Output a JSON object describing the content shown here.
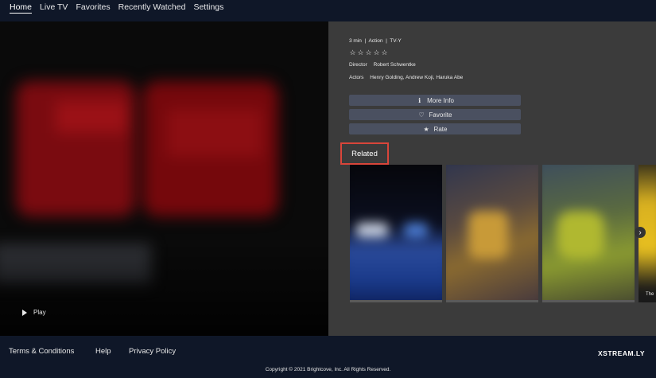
{
  "nav": {
    "items": [
      {
        "label": "Home"
      },
      {
        "label": "Live TV"
      },
      {
        "label": "Favorites"
      },
      {
        "label": "Recently Watched"
      },
      {
        "label": "Settings"
      }
    ]
  },
  "hero": {
    "play_label": "Play"
  },
  "details": {
    "meta": "3 min  |  Action  |  TV-Y",
    "stars": [
      "☆",
      "☆",
      "☆",
      "☆",
      "☆"
    ],
    "director_label": "Director",
    "director": "Robert Schwentke",
    "actors_label": "Actors",
    "actors": "Henry Golding, Andrew Koji, Haruka Abe",
    "buttons": {
      "more_info": "More Info",
      "favorite": "Favorite",
      "rate": "Rate"
    },
    "icons": {
      "more_info": "ℹ",
      "favorite": "♡",
      "rate": "★"
    }
  },
  "related": {
    "title": "Related",
    "partial_label": "The",
    "arrow": "›"
  },
  "footer": {
    "terms": "Terms & Conditions",
    "help": "Help",
    "privacy": "Privacy Policy",
    "logo": "XSTREAM.LY",
    "copyright": "Copyright © 2021 Brightcove, Inc. All Rights Reserved."
  }
}
